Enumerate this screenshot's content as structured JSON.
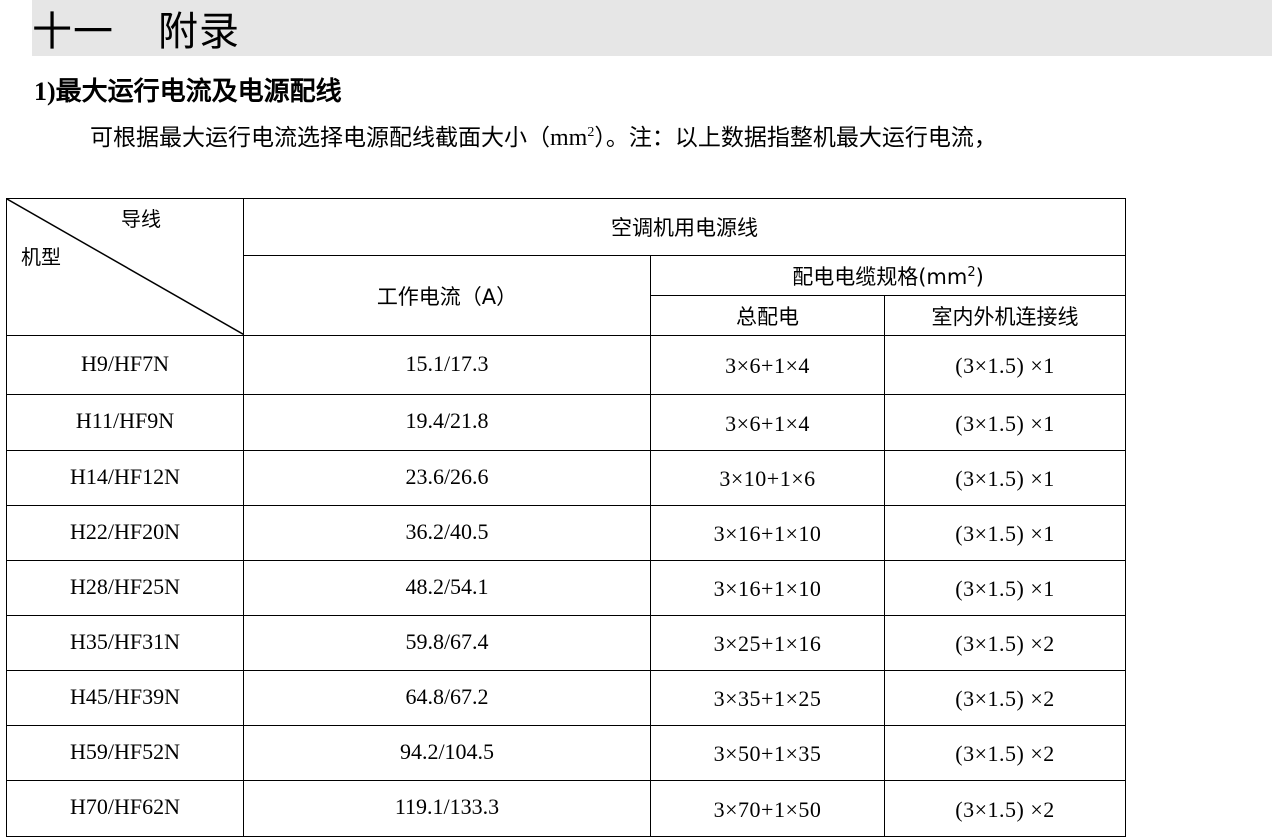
{
  "chapter": {
    "number": "十一",
    "title": "附录"
  },
  "section": {
    "number": "1)",
    "title": "最大运行电流及电源配线"
  },
  "intro": {
    "text_before": "可根据最大运行电流选择电源配线截面大小（",
    "unit": "mm",
    "unit_sup": "2",
    "text_after": "）。注：以上数据指整机最大运行电流，"
  },
  "table": {
    "corner_top": "导线",
    "corner_bottom": "机型",
    "group_header": "空调机用电源线",
    "current_header": "工作电流（A）",
    "cable_header": "配电电缆规格(mm",
    "cable_header_sup": "2",
    "cable_header_close": ")",
    "total_header": "总配电",
    "link_header": "室内外机连接线",
    "rows": [
      {
        "model": "H9/HF7N",
        "current": "15.1/17.3",
        "total": "3×6+1×4",
        "link": "(3×1.5) ×1"
      },
      {
        "model": "H11/HF9N",
        "current": "19.4/21.8",
        "total": "3×6+1×4",
        "link": "(3×1.5) ×1"
      },
      {
        "model": "H14/HF12N",
        "current": "23.6/26.6",
        "total": "3×10+1×6",
        "link": "(3×1.5) ×1"
      },
      {
        "model": "H22/HF20N",
        "current": "36.2/40.5",
        "total": "3×16+1×10",
        "link": "(3×1.5) ×1"
      },
      {
        "model": "H28/HF25N",
        "current": "48.2/54.1",
        "total": "3×16+1×10",
        "link": "(3×1.5) ×1"
      },
      {
        "model": "H35/HF31N",
        "current": "59.8/67.4",
        "total": "3×25+1×16",
        "link": "(3×1.5) ×2"
      },
      {
        "model": "H45/HF39N",
        "current": "64.8/67.2",
        "total": "3×35+1×25",
        "link": "(3×1.5) ×2"
      },
      {
        "model": "H59/HF52N",
        "current": "94.2/104.5",
        "total": "3×50+1×35",
        "link": "(3×1.5) ×2"
      },
      {
        "model": "H70/HF62N",
        "current": "119.1/133.3",
        "total": "3×70+1×50",
        "link": "(3×1.5) ×2"
      }
    ]
  }
}
